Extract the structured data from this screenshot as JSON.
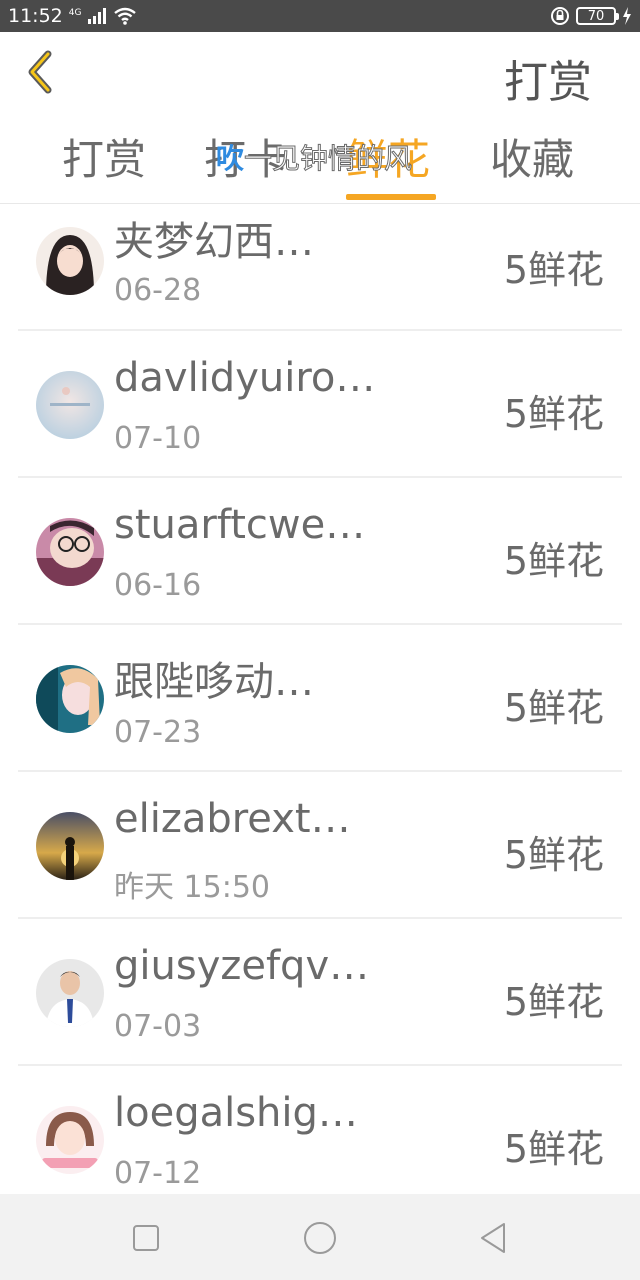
{
  "status_bar": {
    "time": "11:52",
    "network": "4G",
    "battery": "70"
  },
  "header": {
    "back_icon": "chevron-left-icon",
    "action_label": "打赏"
  },
  "tabs": [
    {
      "label": "打赏",
      "active": false
    },
    {
      "label": "打卡",
      "active": false
    },
    {
      "label": "鲜花",
      "active": true
    },
    {
      "label": "收藏",
      "active": false
    }
  ],
  "overlay_toast": {
    "lead": "吹",
    "rest": "一见钟情的风"
  },
  "accent_color": "#f5a623",
  "list": [
    {
      "name": "夹梦幻西…",
      "date": "06-28",
      "amount": "5鲜花"
    },
    {
      "name": "davlidyuiro…",
      "date": "07-10",
      "amount": "5鲜花"
    },
    {
      "name": "stuarftcwe…",
      "date": "06-16",
      "amount": "5鲜花"
    },
    {
      "name": "跟陛哆动…",
      "date": "07-23",
      "amount": "5鲜花"
    },
    {
      "name": "elizabrext…",
      "date": "昨天 15:50",
      "amount": "5鲜花"
    },
    {
      "name": "giusyzefqv…",
      "date": "07-03",
      "amount": "5鲜花"
    },
    {
      "name": "loegalshig…",
      "date": "07-12",
      "amount": "5鲜花"
    }
  ],
  "nav_bar": {
    "buttons": [
      "recent-apps-icon",
      "home-icon",
      "back-icon"
    ]
  }
}
